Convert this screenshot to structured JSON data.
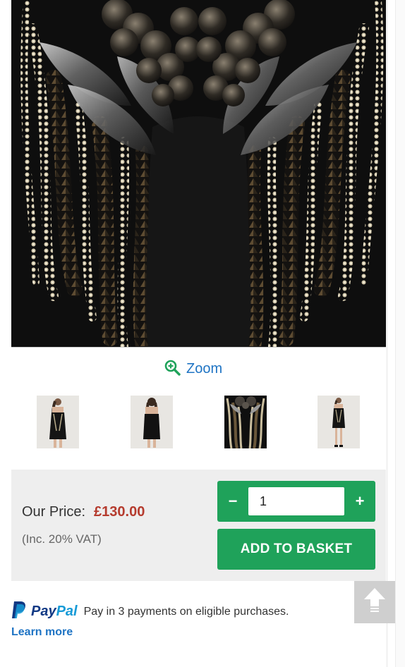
{
  "product": {
    "main_image": "embellished black dress detail",
    "zoom_label": "Zoom",
    "thumbnails": [
      {
        "alt": "dress front view"
      },
      {
        "alt": "dress back view"
      },
      {
        "alt": "dress detail view"
      },
      {
        "alt": "dress full length view"
      }
    ]
  },
  "pricing": {
    "label": "Our Price:",
    "value": "£130.00",
    "vat_note": "(Inc. 20% VAT)"
  },
  "quantity": {
    "minus_label": "−",
    "value": "1",
    "plus_label": "+"
  },
  "basket": {
    "add_label": "ADD TO BASKET"
  },
  "paypal": {
    "logo_pay": "Pay",
    "logo_pal": "Pal",
    "message": "Pay in 3 payments on eligible purchases.",
    "learn_more": "Learn more"
  },
  "colors": {
    "accent_green": "#1fa25a",
    "price_red": "#b53b2e",
    "link_blue": "#1f74c4"
  },
  "icons": {
    "zoom": "zoom-in-icon",
    "paypal": "paypal-logo-icon",
    "scroll_top": "arrow-up-icon"
  }
}
